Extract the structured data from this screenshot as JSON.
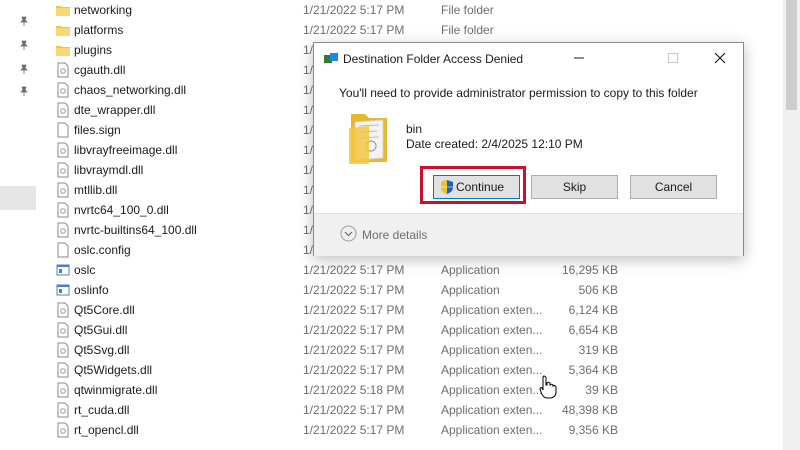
{
  "nav": {
    "pin_icons": [
      "pin-icon",
      "pin-icon",
      "pin-icon",
      "pin-icon"
    ]
  },
  "files": [
    {
      "name": "networking",
      "date": "1/21/2022 5:17 PM",
      "type": "File folder",
      "size": "",
      "icon": "folder-icon"
    },
    {
      "name": "platforms",
      "date": "1/21/2022 5:17 PM",
      "type": "File folder",
      "size": "",
      "icon": "folder-icon"
    },
    {
      "name": "plugins",
      "date": "1/",
      "type": "",
      "size": "",
      "icon": "folder-icon"
    },
    {
      "name": "cgauth.dll",
      "date": "1/",
      "type": "",
      "size": "",
      "icon": "dll-file-icon"
    },
    {
      "name": "chaos_networking.dll",
      "date": "1/",
      "type": "",
      "size": "",
      "icon": "dll-file-icon"
    },
    {
      "name": "dte_wrapper.dll",
      "date": "1/",
      "type": "",
      "size": "",
      "icon": "dll-file-icon"
    },
    {
      "name": "files.sign",
      "date": "1/",
      "type": "",
      "size": "",
      "icon": "file-icon"
    },
    {
      "name": "libvrayfreeimage.dll",
      "date": "1/",
      "type": "",
      "size": "",
      "icon": "dll-file-icon"
    },
    {
      "name": "libvraymdl.dll",
      "date": "1/",
      "type": "",
      "size": "",
      "icon": "dll-file-icon"
    },
    {
      "name": "mtllib.dll",
      "date": "1/",
      "type": "",
      "size": "",
      "icon": "dll-file-icon"
    },
    {
      "name": "nvrtc64_100_0.dll",
      "date": "1/",
      "type": "",
      "size": "",
      "icon": "dll-file-icon"
    },
    {
      "name": "nvrtc-builtins64_100.dll",
      "date": "1/",
      "type": "",
      "size": "",
      "icon": "dll-file-icon"
    },
    {
      "name": "oslc.config",
      "date": "1/",
      "type": "",
      "size": "",
      "icon": "file-icon"
    },
    {
      "name": "oslc",
      "date": "1/21/2022 5:17 PM",
      "type": "Application",
      "size": "16,295 KB",
      "icon": "application-icon"
    },
    {
      "name": "oslinfo",
      "date": "1/21/2022 5:17 PM",
      "type": "Application",
      "size": "506 KB",
      "icon": "application-icon"
    },
    {
      "name": "Qt5Core.dll",
      "date": "1/21/2022 5:17 PM",
      "type": "Application exten...",
      "size": "6,124 KB",
      "icon": "dll-file-icon"
    },
    {
      "name": "Qt5Gui.dll",
      "date": "1/21/2022 5:17 PM",
      "type": "Application exten...",
      "size": "6,654 KB",
      "icon": "dll-file-icon"
    },
    {
      "name": "Qt5Svg.dll",
      "date": "1/21/2022 5:17 PM",
      "type": "Application exten...",
      "size": "319 KB",
      "icon": "dll-file-icon"
    },
    {
      "name": "Qt5Widgets.dll",
      "date": "1/21/2022 5:17 PM",
      "type": "Application exten...",
      "size": "5,364 KB",
      "icon": "dll-file-icon"
    },
    {
      "name": "qtwinmigrate.dll",
      "date": "1/21/2022 5:18 PM",
      "type": "Application exten...",
      "size": "39 KB",
      "icon": "dll-file-icon"
    },
    {
      "name": "rt_cuda.dll",
      "date": "1/21/2022 5:17 PM",
      "type": "Application exten...",
      "size": "48,398 KB",
      "icon": "dll-file-icon"
    },
    {
      "name": "rt_opencl.dll",
      "date": "1/21/2022 5:17 PM",
      "type": "Application exten...",
      "size": "9,356 KB",
      "icon": "dll-file-icon"
    }
  ],
  "dialog": {
    "title": "Destination Folder Access Denied",
    "message": "You'll need to provide administrator permission to copy to this folder",
    "item_name": "bin",
    "item_date": "Date created: 2/4/2025 12:10 PM",
    "continue_label": "Continue",
    "skip_label": "Skip",
    "cancel_label": "Cancel",
    "more_details_label": "More details"
  },
  "colors": {
    "highlight": "#c8102e",
    "folder": "#f5c542",
    "accent": "#0078d7"
  }
}
